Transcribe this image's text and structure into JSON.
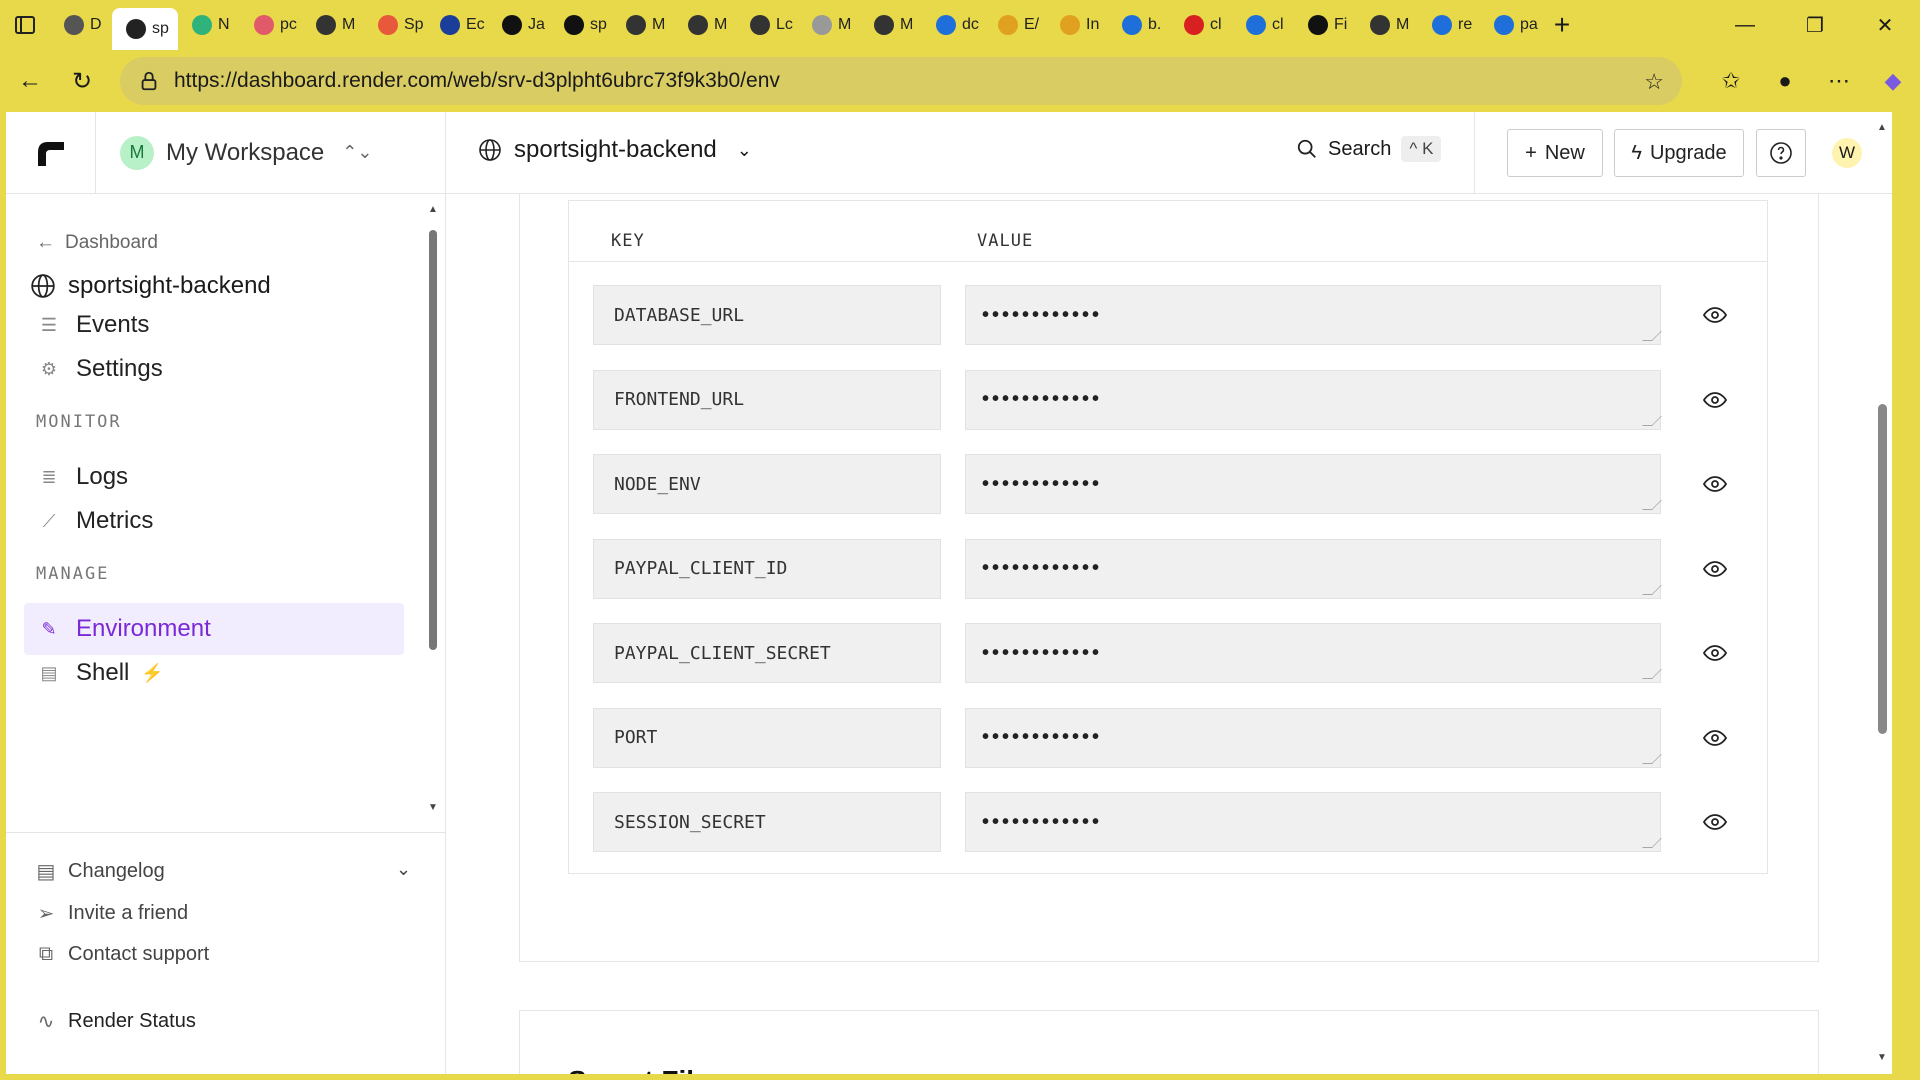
{
  "browser": {
    "tabs": [
      {
        "label": "D",
        "icon": "chatgpt-icon",
        "color": "#555"
      },
      {
        "label": "sp",
        "icon": "render-icon",
        "color": "#222",
        "active": true
      },
      {
        "label": "N",
        "icon": "nx-icon",
        "color": "#2fb37a"
      },
      {
        "label": "pc",
        "icon": "app-icon",
        "color": "#e05a6a"
      },
      {
        "label": "M",
        "icon": "globe-icon",
        "color": "#333"
      },
      {
        "label": "Sp",
        "icon": "app-icon",
        "color": "#e8583a"
      },
      {
        "label": "Ec",
        "icon": "paypal-icon",
        "color": "#1a3e9a"
      },
      {
        "label": "Ja",
        "icon": "github-icon",
        "color": "#111"
      },
      {
        "label": "sp",
        "icon": "triangle-icon",
        "color": "#111"
      },
      {
        "label": "M",
        "icon": "globe-icon",
        "color": "#333"
      },
      {
        "label": "M",
        "icon": "globe-icon",
        "color": "#333"
      },
      {
        "label": "Lc",
        "icon": "globe-icon",
        "color": "#333"
      },
      {
        "label": "M",
        "icon": "globe-icon",
        "color": "#999"
      },
      {
        "label": "M",
        "icon": "globe-icon",
        "color": "#333"
      },
      {
        "label": "dc",
        "icon": "search-icon",
        "color": "#1e6fd9"
      },
      {
        "label": "E/",
        "icon": "gmail-icon",
        "color": "#e0a020"
      },
      {
        "label": "In",
        "icon": "gmail-icon",
        "color": "#e0a020"
      },
      {
        "label": "b.",
        "icon": "search-icon",
        "color": "#1e6fd9"
      },
      {
        "label": "cl",
        "icon": "record-icon",
        "color": "#d92020"
      },
      {
        "label": "cl",
        "icon": "search-icon",
        "color": "#1e6fd9"
      },
      {
        "label": "Fi",
        "icon": "github-icon",
        "color": "#111"
      },
      {
        "label": "M",
        "icon": "globe-icon",
        "color": "#333"
      },
      {
        "label": "re",
        "icon": "search-icon",
        "color": "#1e6fd9"
      },
      {
        "label": "pa",
        "icon": "search-icon",
        "color": "#1e6fd9"
      }
    ],
    "url": "https://dashboard.render.com/web/srv-d3plpht6ubrc73f9k3b0/env"
  },
  "sidebar": {
    "workspace_initial": "M",
    "workspace_name": "My Workspace",
    "back_label": "Dashboard",
    "service_name": "sportsight-backend",
    "nav": [
      {
        "label": "Events",
        "icon": "list-icon"
      },
      {
        "label": "Settings",
        "icon": "gear-icon"
      }
    ],
    "monitor_label": "MONITOR",
    "monitor": [
      {
        "label": "Logs",
        "icon": "logs-icon"
      },
      {
        "label": "Metrics",
        "icon": "chart-icon"
      }
    ],
    "manage_label": "MANAGE",
    "manage": [
      {
        "label": "Environment",
        "icon": "edit-icon",
        "active": true
      },
      {
        "label": "Shell",
        "icon": "terminal-icon"
      }
    ],
    "footer": [
      {
        "label": "Changelog",
        "icon": "book-icon"
      },
      {
        "label": "Invite a friend",
        "icon": "send-icon"
      },
      {
        "label": "Contact support",
        "icon": "external-icon"
      },
      {
        "label": "Render Status",
        "icon": "pulse-icon"
      }
    ]
  },
  "topbar": {
    "service_name": "sportsight-backend",
    "search_label": "Search",
    "search_shortcut": "^ K",
    "new_label": "New",
    "upgrade_label": "Upgrade",
    "user_initial": "W"
  },
  "env": {
    "col_key": "KEY",
    "col_value": "VALUE",
    "masked_value": "••••••••••••",
    "rows": [
      {
        "key": "DATABASE_URL"
      },
      {
        "key": "FRONTEND_URL"
      },
      {
        "key": "NODE_ENV"
      },
      {
        "key": "PAYPAL_CLIENT_ID"
      },
      {
        "key": "PAYPAL_CLIENT_SECRET"
      },
      {
        "key": "PORT"
      },
      {
        "key": "SESSION_SECRET"
      }
    ]
  },
  "secret_files": {
    "title": "Secret Files"
  },
  "colors": {
    "accent": "#7a29d6",
    "browser_frame": "#e8d94a"
  }
}
